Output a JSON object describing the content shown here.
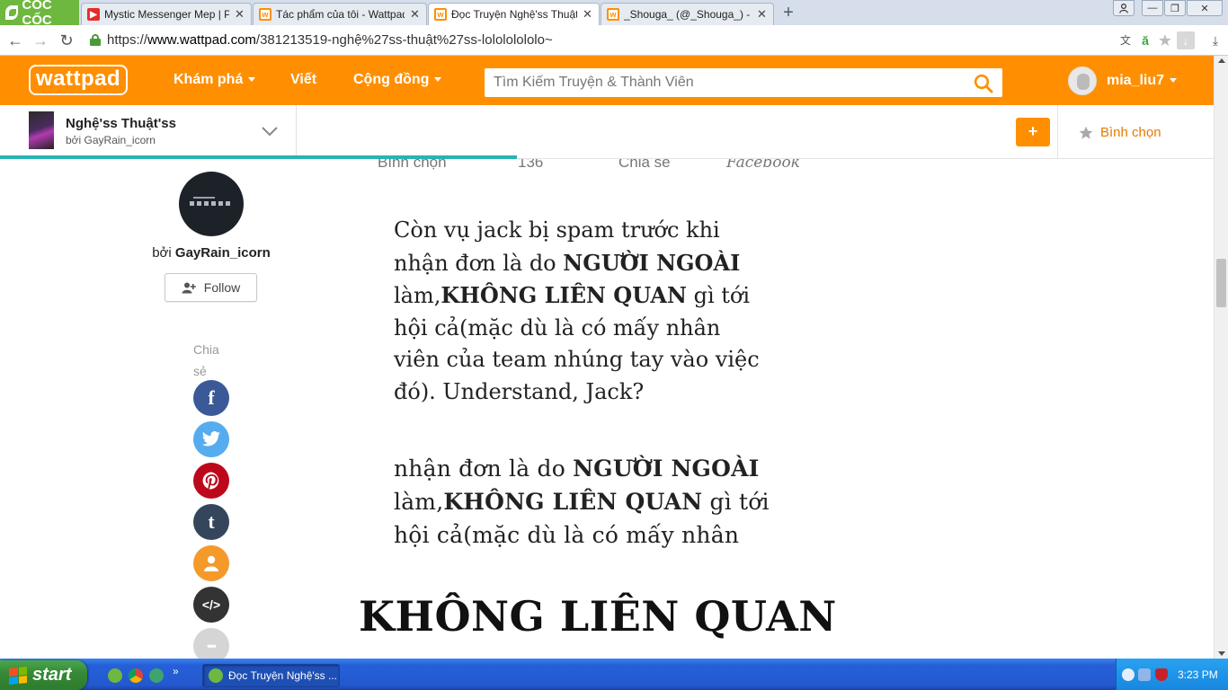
{
  "browser": {
    "brand": "CỐC CỐC",
    "tabs": [
      {
        "title": "Mystic Messenger Mep | Paci",
        "favicon": "youtube-icon"
      },
      {
        "title": "Tác phẩm của tôi - Wattpad",
        "favicon": "wattpad-icon"
      },
      {
        "title": "Đọc Truyện Nghệ'ss Thuật'ss",
        "favicon": "wattpad-icon",
        "active": true
      },
      {
        "title": "_Shouga_ (@_Shouga_) - Wa",
        "favicon": "wattpad-icon"
      }
    ],
    "url_scheme": "https://",
    "url_host": "www.wattpad.com",
    "url_path": "/381213519-nghệ%27ss-thuật%27ss-lolololololo~"
  },
  "header": {
    "logo": "wattpad",
    "nav": [
      {
        "label": "Khám phá",
        "dropdown": true
      },
      {
        "label": "Viết",
        "dropdown": false
      },
      {
        "label": "Cộng đồng",
        "dropdown": true
      }
    ],
    "search_placeholder": "Tìm Kiếm Truyện & Thành Viên",
    "username": "mia_liu7",
    "accent_color": "#ff8f00"
  },
  "story_bar": {
    "title": "Nghệ'ss Thuật'ss",
    "author": "bởi GayRain_icorn",
    "add_label": "+",
    "vote_label": "Bình chọn",
    "reading_progress": 0.426
  },
  "sidebar": {
    "by_prefix": "bởi",
    "author_name": "GayRain_icorn",
    "follow_label": "Follow",
    "share_label": "Chia sẻ",
    "share_buttons": [
      {
        "name": "facebook-share-button",
        "glyph": "f",
        "color": "#3b5998"
      },
      {
        "name": "twitter-share-button",
        "glyph": "",
        "color": "#55acee"
      },
      {
        "name": "pinterest-share-button",
        "glyph": "P",
        "color": "#bd081c"
      },
      {
        "name": "tumblr-share-button",
        "glyph": "t",
        "color": "#35465c"
      },
      {
        "name": "user-share-button",
        "glyph": "",
        "color": "#f49a2b"
      },
      {
        "name": "embed-share-button",
        "glyph": "</>",
        "color": "#333333"
      },
      {
        "name": "more-share-button",
        "glyph": "•••",
        "color": "#d5d5d5"
      }
    ]
  },
  "content": {
    "meta": {
      "vote_label": "Bình chọn",
      "vote_count": "136",
      "share_label": "Chia sẻ",
      "facebook_label": "Facebook"
    },
    "para1": {
      "l1": "Còn vụ jack bị spam trước khi",
      "l2a": "nhận đơn là do ",
      "l2b": "NGƯỜI NGOÀI",
      "l3a": "làm,",
      "l3b": "KHÔNG LIÊN QUAN",
      "l3c": " gì tới",
      "l4": "hội cả(mặc dù là có mấy nhân",
      "l5": "viên của team nhúng tay vào việc",
      "l6": "đó). Understand, Jack?"
    },
    "para2": {
      "l1a": "nhận đơn là do ",
      "l1b": "NGƯỜI NGOÀI",
      "l2a": "làm,",
      "l2b": "KHÔNG LIÊN QUAN",
      "l2c": " gì tới",
      "l3": "hội cả(mặc dù là có mấy nhân"
    },
    "big_quote": "KHÔNG LIÊN QUAN"
  },
  "taskbar": {
    "start_label": "start",
    "task_label": "Đọc Truyện Nghệ'ss ...",
    "clock": "3:23 PM"
  }
}
